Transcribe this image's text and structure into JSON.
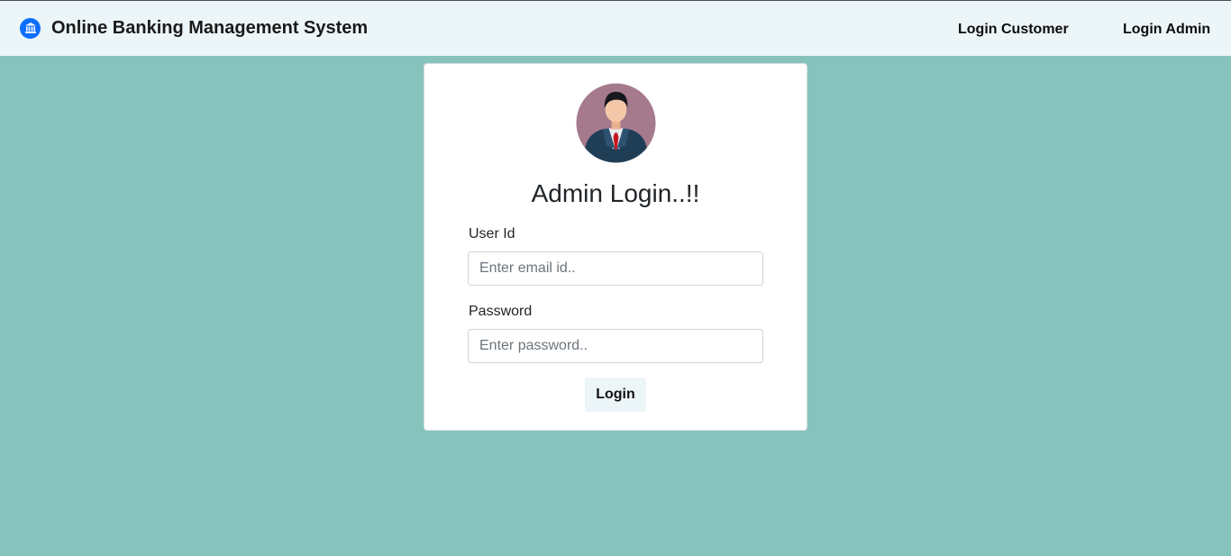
{
  "navbar": {
    "brand_icon": "bank-icon",
    "title": "Online Banking Management System",
    "links": [
      {
        "label": "Login Customer"
      },
      {
        "label": "Login Admin"
      }
    ]
  },
  "login_card": {
    "avatar_icon": "admin-avatar-icon",
    "heading": "Admin Login..!!",
    "user_id": {
      "label": "User Id",
      "placeholder": "Enter email id..",
      "value": ""
    },
    "password": {
      "label": "Password",
      "placeholder": "Enter password..",
      "value": ""
    },
    "submit_label": "Login"
  },
  "colors": {
    "page_background": "#86c3bc",
    "navbar_background": "#ecf5f8",
    "brand_icon": "#0d6efd",
    "avatar_circle": "#a67a8d"
  }
}
